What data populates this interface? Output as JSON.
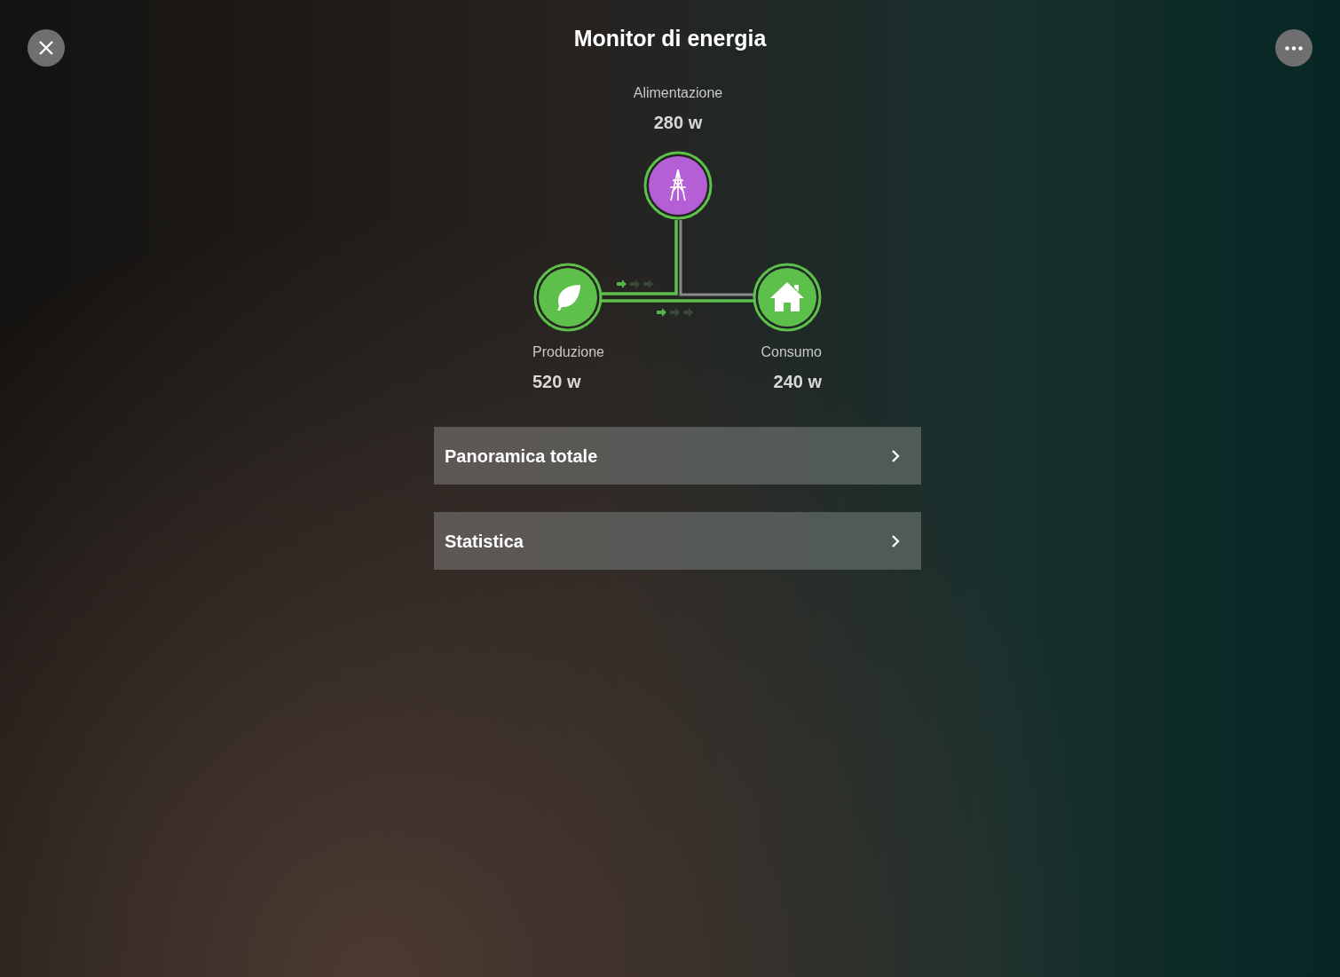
{
  "header": {
    "title": "Monitor di energia"
  },
  "nodes": [
    {
      "kind": "grid",
      "label": "Alimentazione",
      "value": "280 w"
    },
    {
      "kind": "production",
      "label": "Produzione",
      "value": "520 w"
    },
    {
      "kind": "consumption",
      "label": "Consumo",
      "value": "240 w"
    }
  ],
  "menu": [
    {
      "label": "Panoramica totale"
    },
    {
      "label": "Statistica"
    }
  ]
}
